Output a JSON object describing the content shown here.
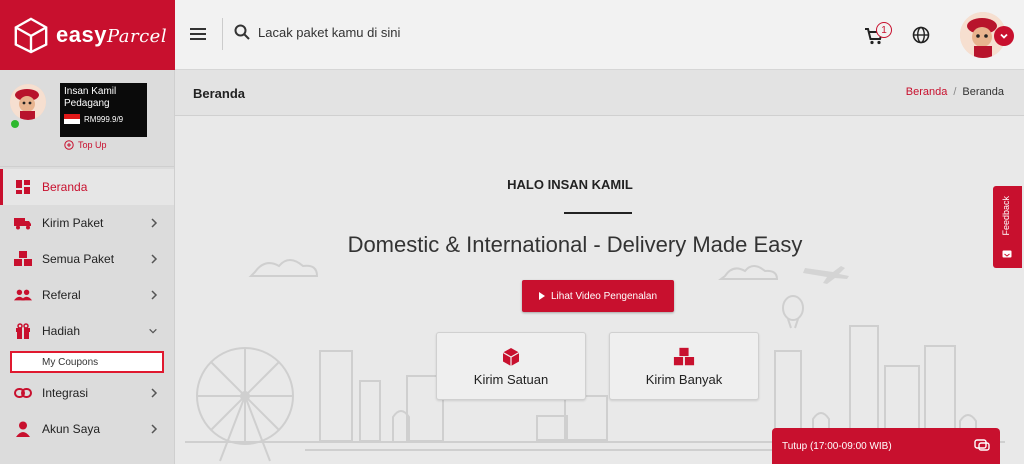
{
  "header": {
    "brand_name": "easy",
    "brand_script": "Parcel",
    "search_placeholder": "Lacak paket kamu di sini",
    "cart_count": "1"
  },
  "profile": {
    "name_line1": "Insan Kamil",
    "name_line2": "Pedagang",
    "balance": "RM999.9/9",
    "topup_label": "Top Up"
  },
  "sidebar": {
    "items": [
      {
        "label": "Beranda",
        "icon": "dashboard-icon",
        "active": true
      },
      {
        "label": "Kirim Paket",
        "icon": "truck-icon"
      },
      {
        "label": "Semua Paket",
        "icon": "boxes-icon"
      },
      {
        "label": "Referal",
        "icon": "users-icon"
      },
      {
        "label": "Hadiah",
        "icon": "gift-icon"
      },
      {
        "label": "Integrasi",
        "icon": "link-icon"
      },
      {
        "label": "Akun Saya",
        "icon": "user-icon"
      }
    ],
    "submenu_label": "My Coupons"
  },
  "page": {
    "title": "Beranda",
    "breadcrumb_link": "Beranda",
    "breadcrumb_current": "Beranda"
  },
  "hero": {
    "greeting": "HALO INSAN KAMIL",
    "tagline": "Domestic & International - Delivery Made Easy",
    "video_button": "Lihat Video Pengenalan",
    "card_single": "Kirim Satuan",
    "card_bulk": "Kirim Banyak"
  },
  "widgets": {
    "feedback_label": "Feedback",
    "chat_label": "Tutup (17:00-09:00 WIB)"
  },
  "colors": {
    "brand": "#c8102e",
    "online": "#2eb82e"
  }
}
